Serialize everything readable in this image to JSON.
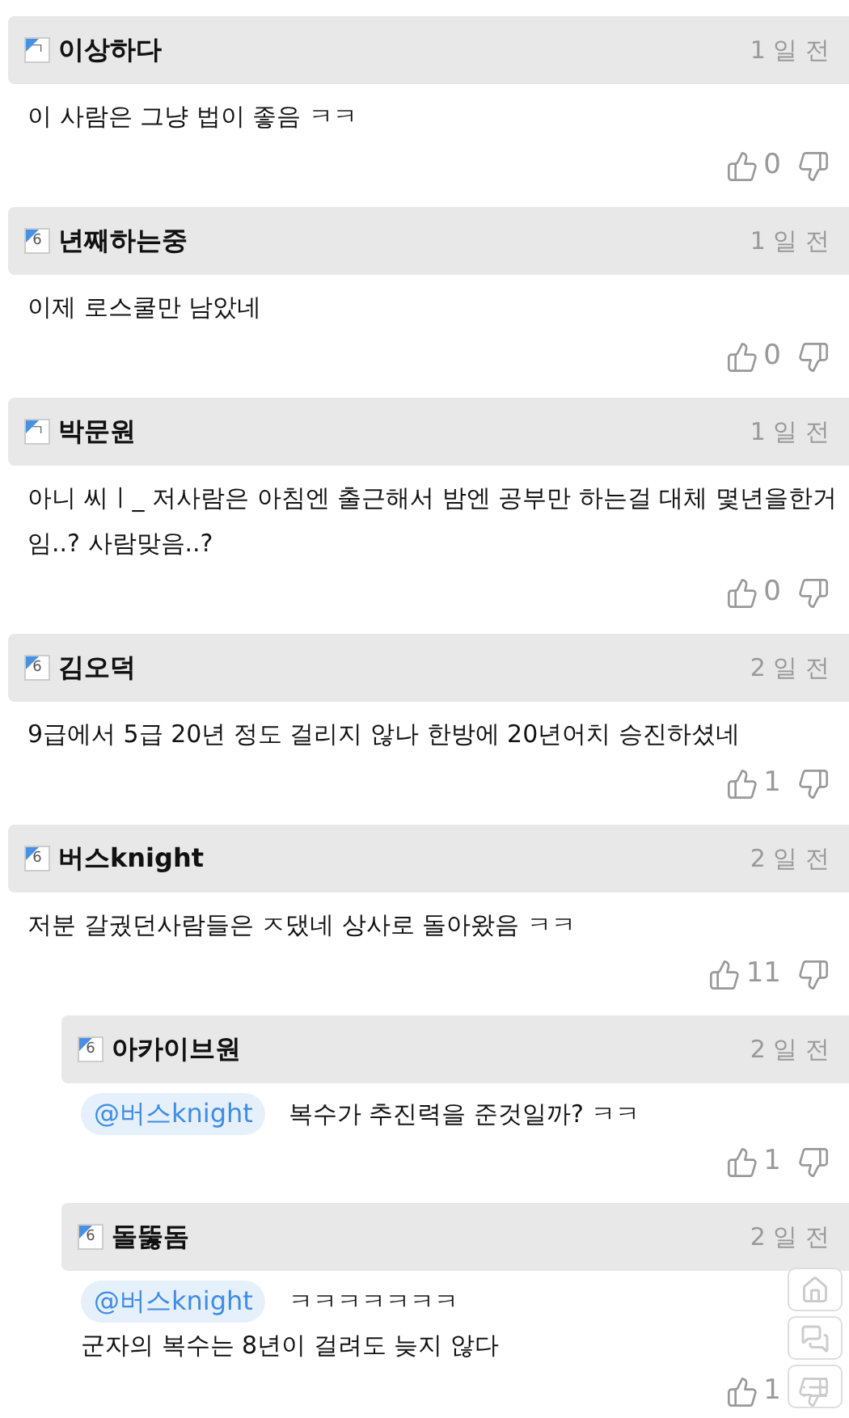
{
  "comments": [
    {
      "author": "이상하다",
      "badge": "ㄱ",
      "time": "1 일 전",
      "text": "이 사람은 그냥 법이 좋음 ㅋㅋ",
      "likes": "0"
    },
    {
      "author": "년째하는중",
      "badge": "6",
      "time": "1 일 전",
      "text": "이제 로스쿨만 남았네",
      "likes": "0"
    },
    {
      "author": "박문원",
      "badge": "ㄱ",
      "time": "1 일 전",
      "text": "아니 씨ㅣ_ 저사람은 아침엔 출근해서 밤엔 공부만 하는걸 대체 몇년을한거임..? 사람맞음..?",
      "likes": "0"
    },
    {
      "author": "김오덕",
      "badge": "6",
      "time": "2 일 전",
      "text": "9급에서 5급 20년 정도 걸리지 않나 한방에 20년어치 승진하셨네",
      "likes": "1"
    },
    {
      "author": "버스knight",
      "badge": "6",
      "time": "2 일 전",
      "text": "저분 갈궜던사람들은 ㅈ댔네 상사로 돌아왔음 ㅋㅋ",
      "likes": "11",
      "replies": [
        {
          "author": "아카이브원",
          "badge": "6",
          "time": "2 일 전",
          "mention": "@버스knight",
          "text": "복수가 추진력을 준것일까? ㅋㅋ",
          "likes": "1"
        },
        {
          "author": "돌뚫돔",
          "badge": "6",
          "time": "2 일 전",
          "mention": "@버스knight",
          "text": "ㅋㅋㅋㅋㅋㅋㅋ",
          "text2": "군자의 복수는 8년이 걸려도 늦지 않다",
          "likes": "1"
        }
      ]
    }
  ]
}
